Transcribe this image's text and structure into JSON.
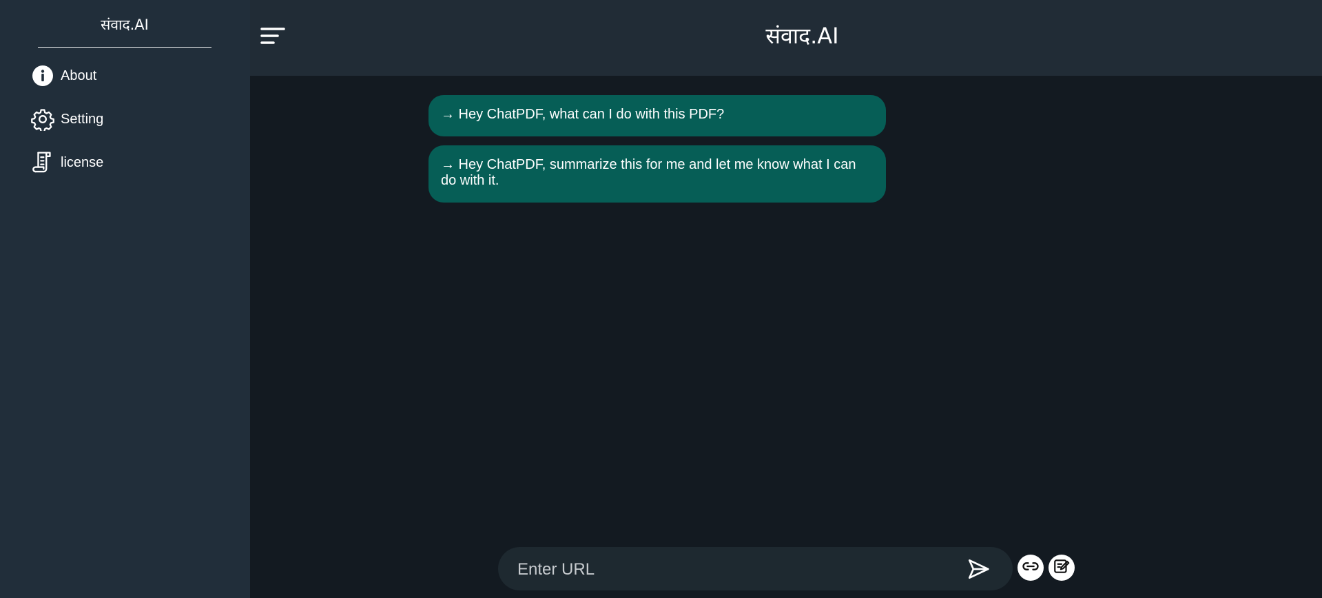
{
  "app": {
    "brand": "संवाद.AI",
    "header_title": "संवाद.AI"
  },
  "sidebar": {
    "items": [
      {
        "label": "About",
        "icon": "info-icon"
      },
      {
        "label": "Setting",
        "icon": "gear-icon"
      },
      {
        "label": "license",
        "icon": "scroll-icon"
      }
    ]
  },
  "chat": {
    "suggestions": [
      "→ Hey ChatPDF, what can I do with this PDF?",
      "→ Hey ChatPDF, summarize this for me and let me know what I can do with it."
    ]
  },
  "input": {
    "placeholder": "Enter URL",
    "value": ""
  },
  "icons": {
    "menu": "menu-icon",
    "send": "send-icon",
    "link": "link-icon",
    "edit": "edit-icon"
  },
  "colors": {
    "sidebar_bg": "#212e3a",
    "header_bg": "#212c36",
    "main_bg": "#131a21",
    "bubble_bg": "#065e56",
    "input_bg": "#1e2930"
  }
}
